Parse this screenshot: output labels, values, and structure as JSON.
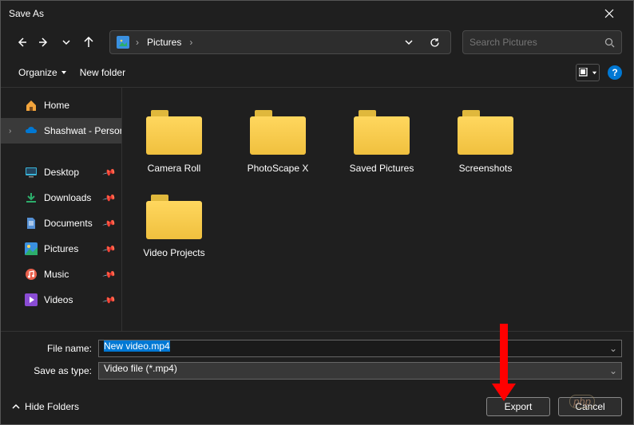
{
  "window": {
    "title": "Save As"
  },
  "nav": {
    "breadcrumb_root": "Pictures",
    "search_placeholder": "Search Pictures"
  },
  "toolbar": {
    "organize": "Organize",
    "new_folder": "New folder"
  },
  "sidebar": {
    "home": "Home",
    "personal": "Shashwat - Personal",
    "quick": [
      {
        "label": "Desktop",
        "icon": "desktop"
      },
      {
        "label": "Downloads",
        "icon": "downloads"
      },
      {
        "label": "Documents",
        "icon": "documents"
      },
      {
        "label": "Pictures",
        "icon": "pictures"
      },
      {
        "label": "Music",
        "icon": "music"
      },
      {
        "label": "Videos",
        "icon": "videos"
      }
    ]
  },
  "folders": [
    "Camera Roll",
    "PhotoScape X",
    "Saved Pictures",
    "Screenshots",
    "Video Projects"
  ],
  "form": {
    "filename_label": "File name:",
    "filename_value": "New video.mp4",
    "type_label": "Save as type:",
    "type_value": "Video file (*.mp4)"
  },
  "footer": {
    "hide_folders": "Hide Folders",
    "export": "Export",
    "cancel": "Cancel"
  },
  "watermark": "php"
}
